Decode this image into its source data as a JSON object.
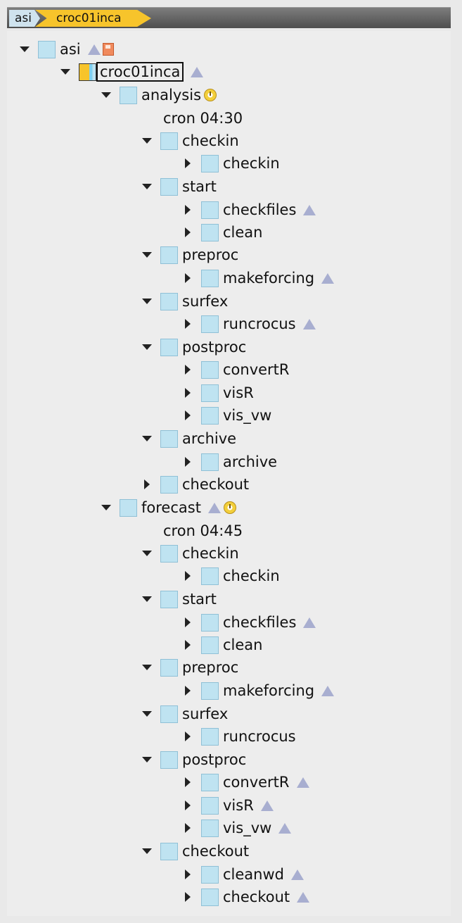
{
  "breadcrumb": {
    "root": "asi",
    "current": "croc01inca"
  },
  "tree": {
    "root": "asi",
    "suite": "croc01inca",
    "analysis": {
      "name": "analysis",
      "cron": "cron 04:30",
      "checkin": "checkin",
      "checkin_task": "checkin",
      "start": "start",
      "checkfiles": "checkfiles",
      "clean": "clean",
      "preproc": "preproc",
      "makeforcing": "makeforcing",
      "surfex": "surfex",
      "runcrocus": "runcrocus",
      "postproc": "postproc",
      "convertR": "convertR",
      "visR": "visR",
      "vis_vw": "vis_vw",
      "archive": "archive",
      "archive_task": "archive",
      "checkout": "checkout"
    },
    "forecast": {
      "name": "forecast",
      "cron": "cron 04:45",
      "checkin": "checkin",
      "checkin_task": "checkin",
      "start": "start",
      "checkfiles": "checkfiles",
      "clean": "clean",
      "preproc": "preproc",
      "makeforcing": "makeforcing",
      "surfex": "surfex",
      "runcrocus": "runcrocus",
      "postproc": "postproc",
      "convertR": "convertR",
      "visR": "visR",
      "vis_vw": "vis_vw",
      "checkout": "checkout",
      "cleanwd": "cleanwd",
      "checkout_task": "checkout"
    }
  },
  "icons": {
    "expand": "triangle-down-icon",
    "collapse": "triangle-right-icon",
    "status": "status-box-icon",
    "up": "up-arrow-icon",
    "clock": "clock-icon",
    "save": "save-icon"
  },
  "colors": {
    "breadcrumb_active": "#f7c42b",
    "status_box": "#bfe3f1",
    "up_icon": "#a8aed0"
  }
}
